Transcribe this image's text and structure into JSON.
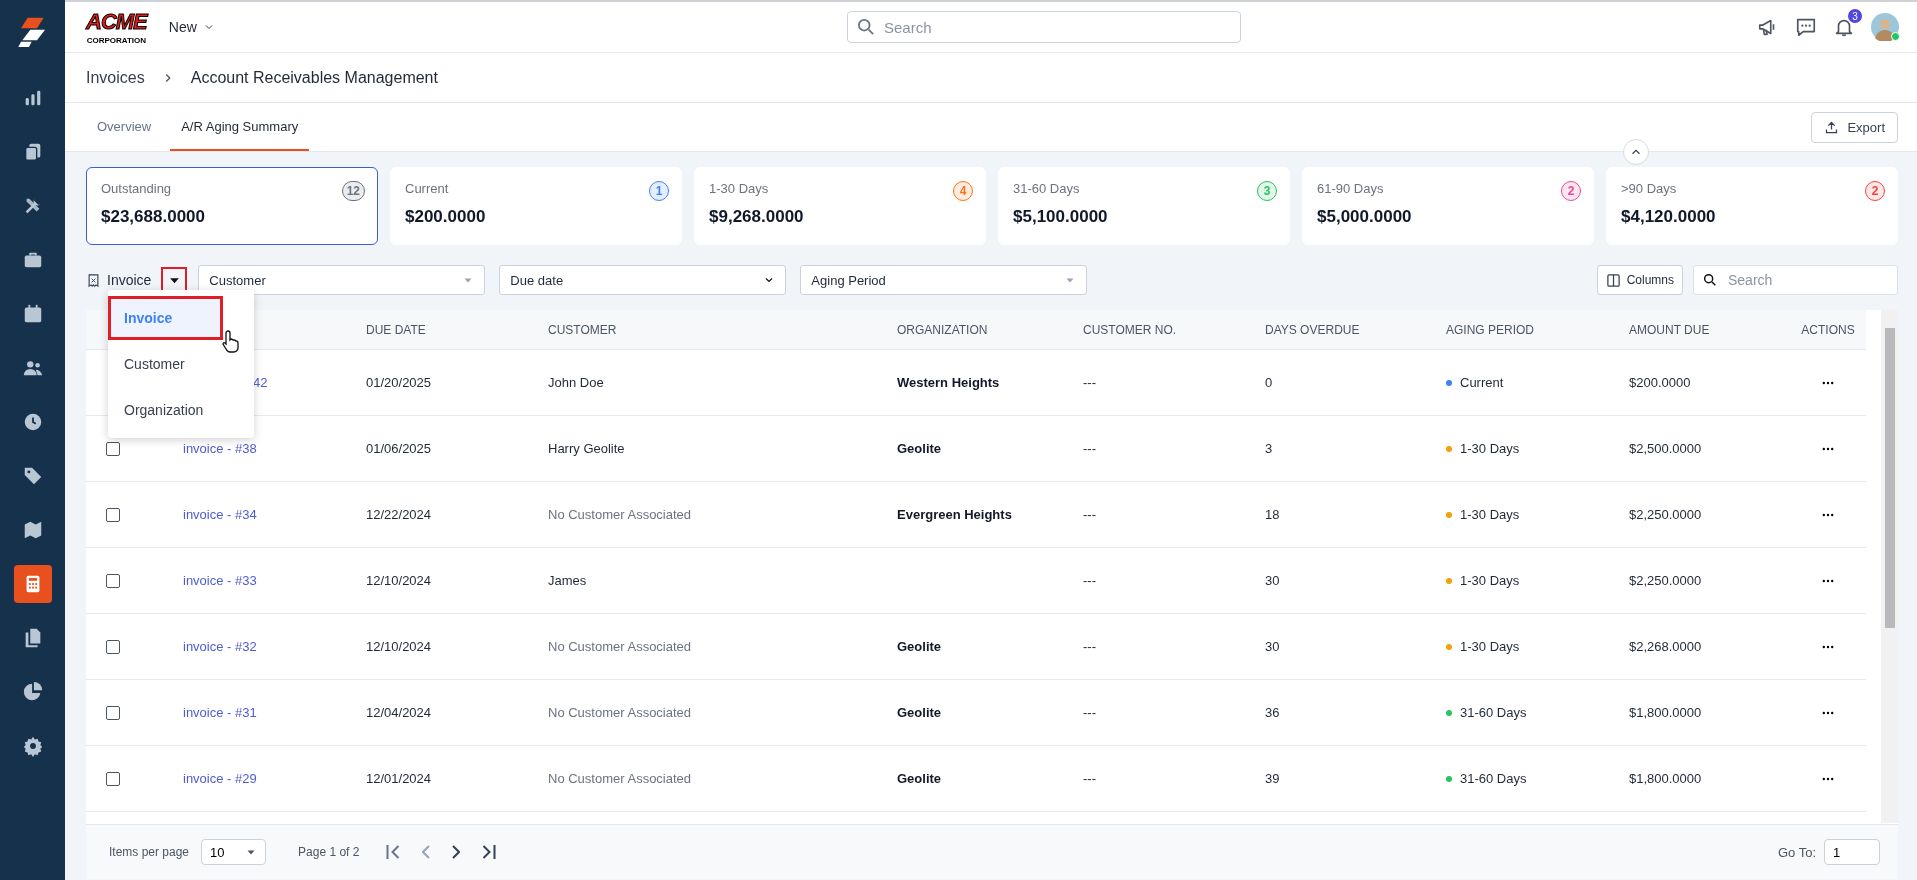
{
  "topbar": {
    "logo": {
      "title": "ACME",
      "subtitle": "CORPORATION"
    },
    "new_menu": "New",
    "search": {
      "placeholder": "Search"
    },
    "notifications": "3",
    "online": true
  },
  "sidebar": {
    "items": [
      {
        "selected": false
      },
      {
        "selected": false
      },
      {
        "selected": false
      },
      {
        "selected": false
      },
      {
        "selected": false
      },
      {
        "selected": false
      },
      {
        "selected": false
      },
      {
        "selected": false
      },
      {
        "selected": false
      },
      {
        "selected": true
      },
      {
        "selected": false
      },
      {
        "selected": false
      },
      {
        "selected": false
      }
    ]
  },
  "breadcrumb": [
    "Invoices",
    "Account Receivables Management"
  ],
  "tabs": [
    {
      "label": "Overview",
      "selected": false
    },
    {
      "label": "A/R Aging Summary",
      "selected": true
    }
  ],
  "export": "Export",
  "cards": [
    {
      "label": "Outstanding",
      "amount": "$23,688.0000",
      "count": "12",
      "color": "#6b7280",
      "selected": true
    },
    {
      "label": "Current",
      "amount": "$200.0000",
      "count": "1",
      "color": "#3b82f6",
      "selected": false
    },
    {
      "label": "1-30 Days",
      "amount": "$9,268.0000",
      "count": "4",
      "color": "#f97316",
      "selected": false
    },
    {
      "label": "31-60 Days",
      "amount": "$5,100.0000",
      "count": "3",
      "color": "#22c55e",
      "selected": false
    },
    {
      "label": "61-90 Days",
      "amount": "$5,000.0000",
      "count": "2",
      "color": "#ec4899",
      "selected": false
    },
    {
      "label": ">90 Days",
      "amount": "$4,120.0000",
      "count": "2",
      "color": "#ef4444",
      "selected": false
    }
  ],
  "filters": {
    "group_by": {
      "label": "Invoice",
      "highlighted": true
    },
    "selects": [
      {
        "label": "Customer",
        "kind": "triangle"
      },
      {
        "label": "Due date",
        "kind": "chevron"
      },
      {
        "label": "Aging Period",
        "kind": "triangle"
      }
    ],
    "columns_button": "Columns",
    "search": {
      "placeholder": "Search"
    }
  },
  "group_menu": [
    {
      "label": "Invoice",
      "selected": true
    },
    {
      "label": "Customer",
      "selected": false
    },
    {
      "label": "Organization",
      "selected": false
    }
  ],
  "table": {
    "columns": [
      "DUE DATE",
      "CUSTOMER",
      "ORGANIZATION",
      "CUSTOMER NO.",
      "DAYS OVERDUE",
      "AGING PERIOD",
      "AMOUNT DUE",
      "ACTIONS"
    ],
    "rows": [
      {
        "invoice": "42",
        "due": "01/20/2025",
        "customer": "John Doe",
        "customer_linked": true,
        "organization": "Western Heights",
        "customer_no": "---",
        "days": "0",
        "aging": "Current",
        "color": "#3b82f6",
        "amount": "$200.0000"
      },
      {
        "checked": false,
        "invoice": "invoice - #38",
        "due": "01/06/2025",
        "customer": "Harry Geolite",
        "customer_linked": true,
        "organization": "Geolite",
        "customer_no": "---",
        "days": "3",
        "aging": "1-30 Days",
        "color": "#f59e0b",
        "amount": "$2,500.0000"
      },
      {
        "checked": false,
        "invoice": "invoice - #34",
        "due": "12/22/2024",
        "customer": "No Customer Associated",
        "customer_linked": false,
        "organization": "Evergreen Heights",
        "customer_no": "---",
        "days": "18",
        "aging": "1-30 Days",
        "color": "#f59e0b",
        "amount": "$2,250.0000"
      },
      {
        "checked": false,
        "invoice": "invoice - #33",
        "due": "12/10/2024",
        "customer": "James",
        "customer_linked": true,
        "customer_no": "---",
        "days": "30",
        "aging": "1-30 Days",
        "color": "#f59e0b",
        "amount": "$2,250.0000"
      },
      {
        "checked": false,
        "invoice": "invoice - #32",
        "due": "12/10/2024",
        "customer": "No Customer Associated",
        "customer_linked": false,
        "organization": "Geolite",
        "customer_no": "---",
        "days": "30",
        "aging": "1-30 Days",
        "color": "#f59e0b",
        "amount": "$2,268.0000"
      },
      {
        "checked": false,
        "invoice": "invoice - #31",
        "due": "12/04/2024",
        "customer": "No Customer Associated",
        "customer_linked": false,
        "organization": "Geolite",
        "customer_no": "---",
        "days": "36",
        "aging": "31-60 Days",
        "color": "#22c55e",
        "amount": "$1,800.0000"
      },
      {
        "checked": false,
        "invoice": "invoice - #29",
        "due": "12/01/2024",
        "customer": "No Customer Associated",
        "customer_linked": false,
        "organization": "Geolite",
        "customer_no": "---",
        "days": "39",
        "aging": "31-60 Days",
        "color": "#22c55e",
        "amount": "$1,800.0000"
      }
    ]
  },
  "footer": {
    "items_label": "Items per page",
    "per_page": "10",
    "page": "Page 1 of 2",
    "goto_label": "Go To:",
    "goto_value": "1"
  }
}
